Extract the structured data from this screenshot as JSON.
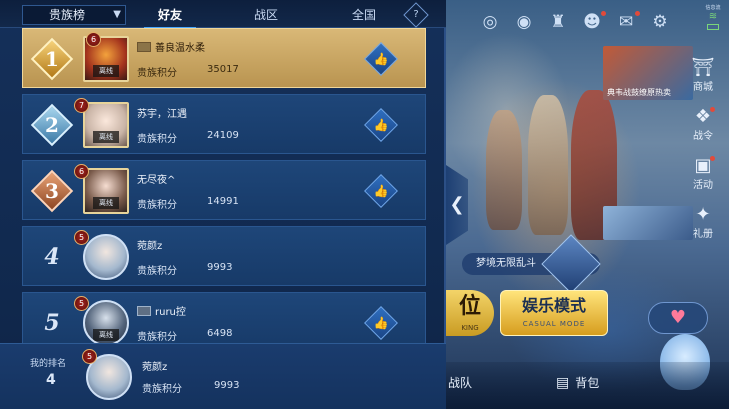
{
  "tabs": {
    "dropdown_label": "贵族榜",
    "items": [
      {
        "label": "好友",
        "active": true
      },
      {
        "label": "战区",
        "active": false
      },
      {
        "label": "全国",
        "active": false
      }
    ],
    "help_glyph": "?"
  },
  "score_label": "贵族积分",
  "offline_label": "离线",
  "leaderboard": [
    {
      "rank": "1",
      "level": "6",
      "name": "善良温水柔",
      "has_card_icon": true,
      "score": "35017",
      "offline": true
    },
    {
      "rank": "2",
      "level": "7",
      "name": "苏宇，江遇",
      "has_card_icon": false,
      "score": "24109",
      "offline": true
    },
    {
      "rank": "3",
      "level": "6",
      "name": "无尽夜^",
      "has_card_icon": false,
      "score": "14991",
      "offline": true
    },
    {
      "rank": "4",
      "level": "5",
      "name": "菀颜z",
      "has_card_icon": false,
      "score": "9993",
      "offline": false
    },
    {
      "rank": "5",
      "level": "5",
      "name": "ruru控",
      "has_card_icon": true,
      "score": "6498",
      "offline": true
    }
  ],
  "my_rank": {
    "label": "我的排名",
    "rank": "4",
    "level": "5",
    "name": "菀颜z",
    "score": "9993"
  },
  "right_side": {
    "status_text": "信息流",
    "menu": [
      {
        "label": "商城",
        "icon": "shop-icon"
      },
      {
        "label": "战令",
        "icon": "battle-pass-icon"
      },
      {
        "label": "活动",
        "icon": "event-icon"
      },
      {
        "label": "礼册",
        "icon": "gift-book-icon"
      }
    ],
    "promo_text": "典韦战鼓缭原热卖",
    "mode_label": "梦境无限乱斗",
    "ranked_button_main": "位",
    "ranked_button_sub": "KING",
    "casual_button_main": "娱乐模式",
    "casual_button_sub": "CASUAL MODE",
    "bottom_team": "战队",
    "bottom_bag": "背包"
  },
  "colors": {
    "accent_blue": "#4aa8ff",
    "gold_row": "#d9b877",
    "panel_bg": "#15305a",
    "notification_red": "#e24a3a"
  }
}
